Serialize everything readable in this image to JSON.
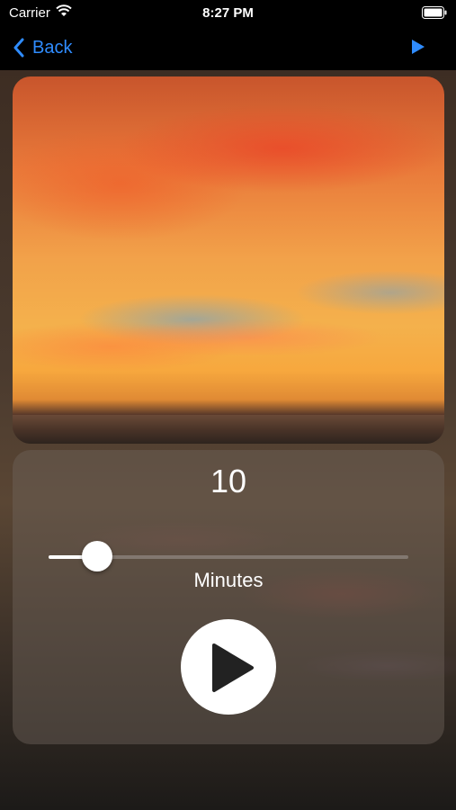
{
  "status_bar": {
    "carrier": "Carrier",
    "time": "8:27 PM",
    "icons": [
      "wifi-icon",
      "battery-icon"
    ]
  },
  "nav": {
    "back_label": "Back",
    "back_icon": "chevron-left-icon",
    "play_icon": "play-icon",
    "accent_color": "#2f8cff"
  },
  "timer": {
    "value": "10",
    "unit_label": "Minutes",
    "slider_fraction": 0.1
  },
  "play_button": {
    "icon": "play-icon"
  }
}
